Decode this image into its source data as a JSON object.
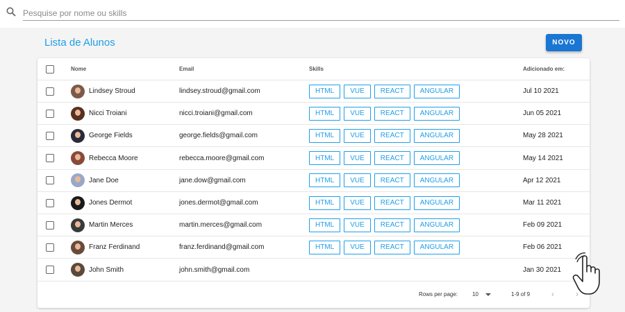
{
  "search": {
    "placeholder": "Pesquise por nome ou skills",
    "value": ""
  },
  "page": {
    "title": "Lista de Alunos",
    "new_label": "NOVO"
  },
  "table": {
    "headers": {
      "name": "Nome",
      "email": "Email",
      "skills": "Skills",
      "added": "Adicionado em:"
    },
    "rows": [
      {
        "name": "Lindsey Stroud",
        "email": "lindsey.stroud@gmail.com",
        "skills": [
          "HTML",
          "VUE",
          "REACT",
          "ANGULAR"
        ],
        "date": "Jul 10 2021",
        "avatar_color": "#7a5a4a"
      },
      {
        "name": "Nicci Troiani",
        "email": "nicci.troiani@gmail.com",
        "skills": [
          "HTML",
          "VUE",
          "REACT",
          "ANGULAR"
        ],
        "date": "Jun 05 2021",
        "avatar_color": "#5a3020"
      },
      {
        "name": "George Fields",
        "email": "george.fields@gmail.com",
        "skills": [
          "HTML",
          "VUE",
          "REACT",
          "ANGULAR"
        ],
        "date": "May 28 2021",
        "avatar_color": "#2a2a3a"
      },
      {
        "name": "Rebecca Moore",
        "email": "rebecca.moore@gmail.com",
        "skills": [
          "HTML",
          "VUE",
          "REACT",
          "ANGULAR"
        ],
        "date": "May 14 2021",
        "avatar_color": "#8a4a3a"
      },
      {
        "name": "Jane Doe",
        "email": "jane.dow@gmail.com",
        "skills": [
          "HTML",
          "VUE",
          "REACT",
          "ANGULAR"
        ],
        "date": "Apr 12 2021",
        "avatar_color": "#9aa8c8"
      },
      {
        "name": "Jones Dermot",
        "email": "jones.dermot@gmail.com",
        "skills": [
          "HTML",
          "VUE",
          "REACT",
          "ANGULAR"
        ],
        "date": "Mar 11 2021",
        "avatar_color": "#1a1a1a"
      },
      {
        "name": "Martin Merces",
        "email": "martin.merces@gmail.com",
        "skills": [
          "HTML",
          "VUE",
          "REACT",
          "ANGULAR"
        ],
        "date": "Feb 09 2021",
        "avatar_color": "#3a3a3a"
      },
      {
        "name": "Franz Ferdinand",
        "email": "franz.ferdinand@gmail.com",
        "skills": [
          "HTML",
          "VUE",
          "REACT",
          "ANGULAR"
        ],
        "date": "Feb 06 2021",
        "avatar_color": "#6a4a3a"
      },
      {
        "name": "John Smith",
        "email": "john.smith@gmail.com",
        "skills": [],
        "date": "Jan 30 2021",
        "avatar_color": "#5a4a3a"
      }
    ]
  },
  "footer": {
    "rows_per_page_label": "Rows per page:",
    "rows_per_page": "10",
    "range": "1-9 of 9",
    "prev_icon": "‹",
    "next_icon": "›"
  },
  "colors": {
    "accent": "#1e9ee8",
    "button": "#1976d2"
  },
  "icons": {
    "search": "search-icon",
    "cursor": "hand-pointer-icon"
  }
}
